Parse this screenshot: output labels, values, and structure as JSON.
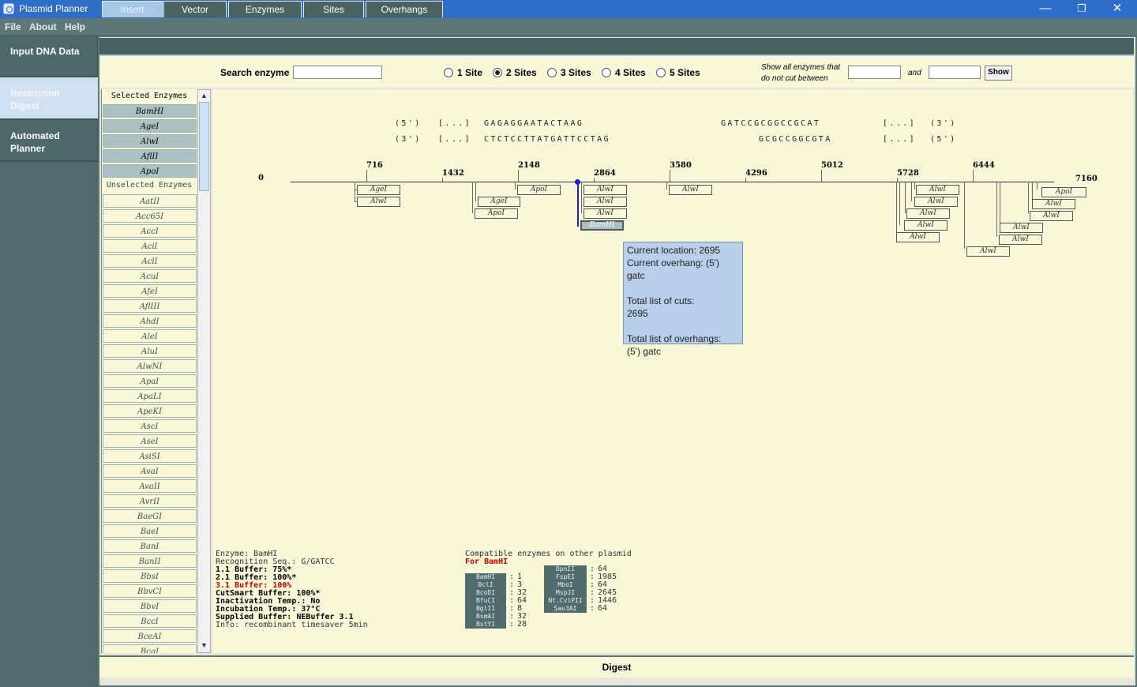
{
  "window": {
    "title": "Plasmid Planner",
    "minimize": "—",
    "restore": "❐",
    "close": "✕"
  },
  "menu": [
    "File",
    "About",
    "Help"
  ],
  "nav": [
    {
      "label": "Input DNA Data"
    },
    {
      "label": "Restriction Digest"
    },
    {
      "label": "Automated Planner"
    }
  ],
  "tabs": [
    "Insert",
    "Vector",
    "Enzymes",
    "Sites",
    "Overhangs"
  ],
  "toolbar": {
    "search_label": "Search enzyme",
    "search_value": "",
    "sites": [
      "1 Site",
      "2 Sites",
      "3 Sites",
      "4 Sites",
      "5 Sites"
    ],
    "selected_site": "2 Sites",
    "show_label_1": "Show all enzymes that",
    "show_label_2": "do not cut between",
    "and_label": "and",
    "from_value": "",
    "to_value": "",
    "show_button": "Show"
  },
  "enzyme_list": {
    "selected_header": "Selected Enzymes",
    "selected": [
      "BamHI",
      "AgeI",
      "AlwI",
      "AflII",
      "ApoI"
    ],
    "unselected_header": "Unselected Enzymes",
    "unselected": [
      "AatII",
      "Acc65I",
      "AccI",
      "AciI",
      "AclI",
      "AcuI",
      "AfeI",
      "AflIII",
      "AhdI",
      "AleI",
      "AluI",
      "AlwNI",
      "ApaI",
      "ApaLI",
      "ApeKI",
      "AscI",
      "AseI",
      "AsiSI",
      "AvaI",
      "AvaII",
      "AvrII",
      "BaeGI",
      "BaeI",
      "BanI",
      "BanII",
      "BbsI",
      "BbvCI",
      "BbvI",
      "BccI",
      "BceAI",
      "BcgI"
    ]
  },
  "sequence": {
    "top_left_end": "(5')",
    "top_left_gap": "[...]",
    "top_left_seq": "GAGAGGAATACTAAG",
    "top_right_seq": "GATCCGCGGCCGCAT",
    "top_right_gap": "[...]",
    "top_right_end": "(3')",
    "bot_left_end": "(3')",
    "bot_left_gap": "[...]",
    "bot_left_seq": "CTCTCCTTATGATTCCTAG",
    "bot_right_seq": "GCGCCGGCGTA",
    "bot_right_gap": "[...]",
    "bot_right_end": "(5')"
  },
  "map": {
    "start": "0",
    "end": "7160",
    "ticks": [
      "716",
      "1432",
      "2148",
      "2864",
      "3580",
      "4296",
      "5012",
      "5728",
      "6444"
    ],
    "cut_labels": [
      "AgeI",
      "AlwI",
      "AgeI",
      "ApoI",
      "ApoI",
      "AlwI",
      "AlwI",
      "AlwI",
      "BamHI",
      "AlwI",
      "AlwI",
      "AlwI",
      "AlwI",
      "AlwI",
      "AlwI",
      "AlwI",
      "ApoI",
      "AlwI",
      "AlwI",
      "AlwI",
      "AlwI"
    ]
  },
  "tooltip": {
    "location": "Current location: 2695",
    "overhang": "Current overhang: (5') gatc",
    "cuts_title": "Total list of cuts:",
    "cuts": "2695",
    "overhangs_title": "Total list of overhangs:",
    "overhangs": "(5') gatc"
  },
  "enzyme_info": {
    "enzyme": "Enzyme: BamHI",
    "recognition": "Recognition Seq.: G/GATCC",
    "buffer11": "1.1 Buffer: 75%*",
    "buffer21": "2.1 Buffer: 100%*",
    "buffer31": "3.1 Buffer: 100%",
    "cutsmart": "CutSmart Buffer: 100%*",
    "inactivation": "Inactivation Temp.: No",
    "incubation": "Incubation Temp.: 37°C",
    "supplied": "Supplied Buffer: NEBuffer 3.1",
    "info": "Info: recombinant timesaver 5min"
  },
  "compatible": {
    "title": "Compatible enzymes on other plasmid",
    "for_label": "For BamHI",
    "left": [
      {
        "name": "BamHI",
        "value": "1"
      },
      {
        "name": "BclI",
        "value": "3"
      },
      {
        "name": "BcoDI",
        "value": "32"
      },
      {
        "name": "BfuCI",
        "value": "64"
      },
      {
        "name": "BglII",
        "value": "8"
      },
      {
        "name": "BsmAI",
        "value": "32"
      },
      {
        "name": "BstYI",
        "value": "28"
      }
    ],
    "right": [
      {
        "name": "DpnII",
        "value": "64"
      },
      {
        "name": "FspEI",
        "value": "1985"
      },
      {
        "name": "MboI",
        "value": "64"
      },
      {
        "name": "MspJI",
        "value": "2645"
      },
      {
        "name": "Nt.CviPII",
        "value": "1446"
      },
      {
        "name": "Sau3AI",
        "value": "64"
      }
    ]
  },
  "bottom": {
    "label": "Digest"
  },
  "colors": {
    "accent": "#2f6ec8",
    "panel": "#f8f8d8",
    "sidebar": "#4f6b6b",
    "highlight": "#a8c7e6",
    "cut_marker": "#1f1fd0"
  }
}
